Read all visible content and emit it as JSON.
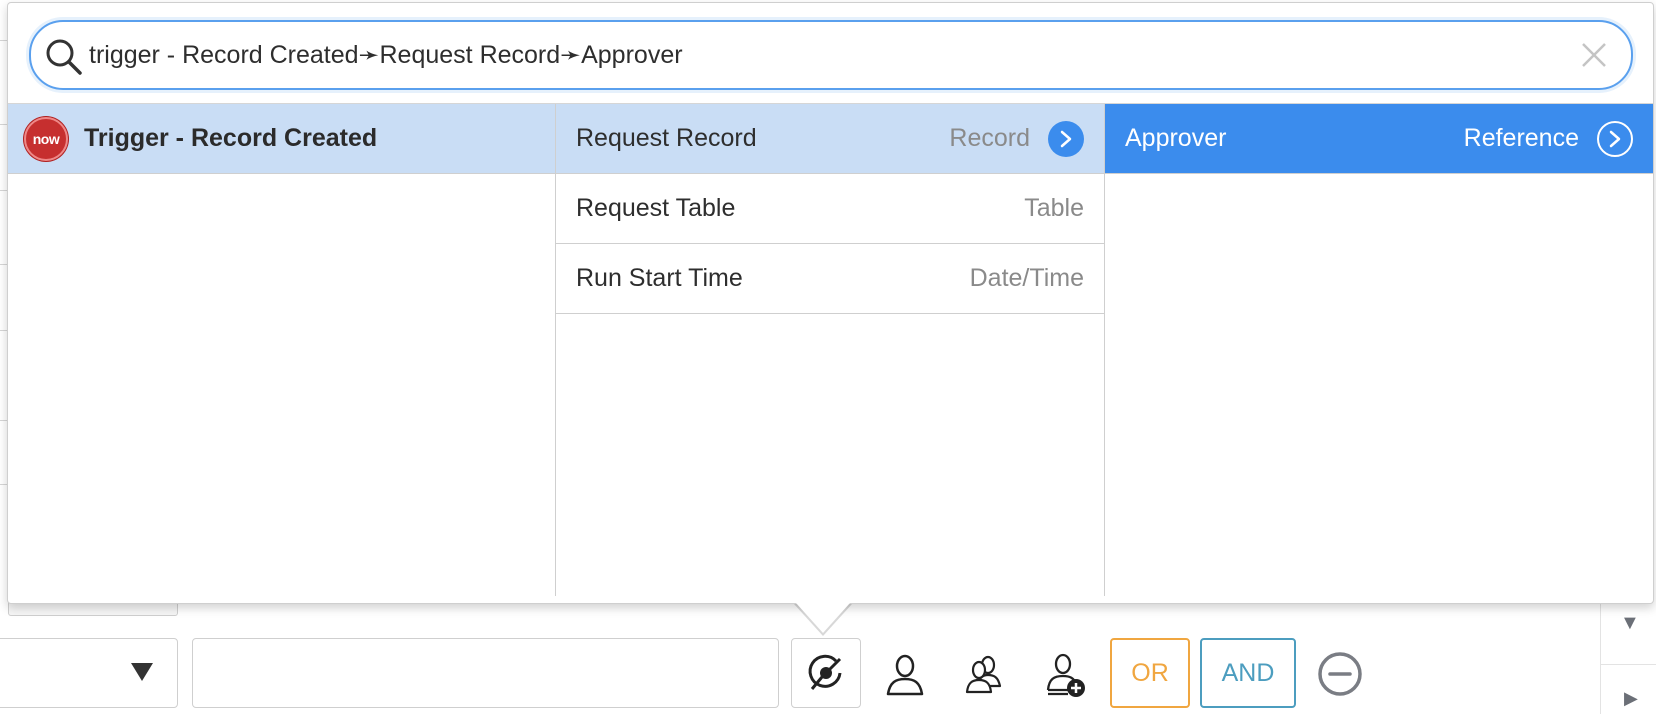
{
  "search": {
    "value": "trigger - Record Created➛Request Record➛Approver"
  },
  "columns": {
    "col1": [
      {
        "label": "Trigger - Record Created",
        "badge": "now"
      }
    ],
    "col2": [
      {
        "label": "Request Record",
        "type": "Record"
      },
      {
        "label": "Request Table",
        "type": "Table"
      },
      {
        "label": "Run Start Time",
        "type": "Date/Time"
      }
    ],
    "col3": [
      {
        "label": "Approver",
        "type": "Reference"
      }
    ]
  },
  "toolbar": {
    "or_label": "OR",
    "and_label": "AND"
  },
  "colors": {
    "selected_light": "#c9ddf5",
    "selected_dark": "#3b8ced",
    "or": "#f0a640",
    "and": "#4c9dbf",
    "badge": "#c62f2f"
  },
  "icons": {
    "search": "search-icon",
    "clear": "close-icon",
    "chevron": "chevron-right-icon",
    "data_pill": "data-pill-picker-icon",
    "user": "user-icon",
    "group": "group-icon",
    "add_user": "add-user-icon",
    "remove": "minus-circle-icon"
  }
}
